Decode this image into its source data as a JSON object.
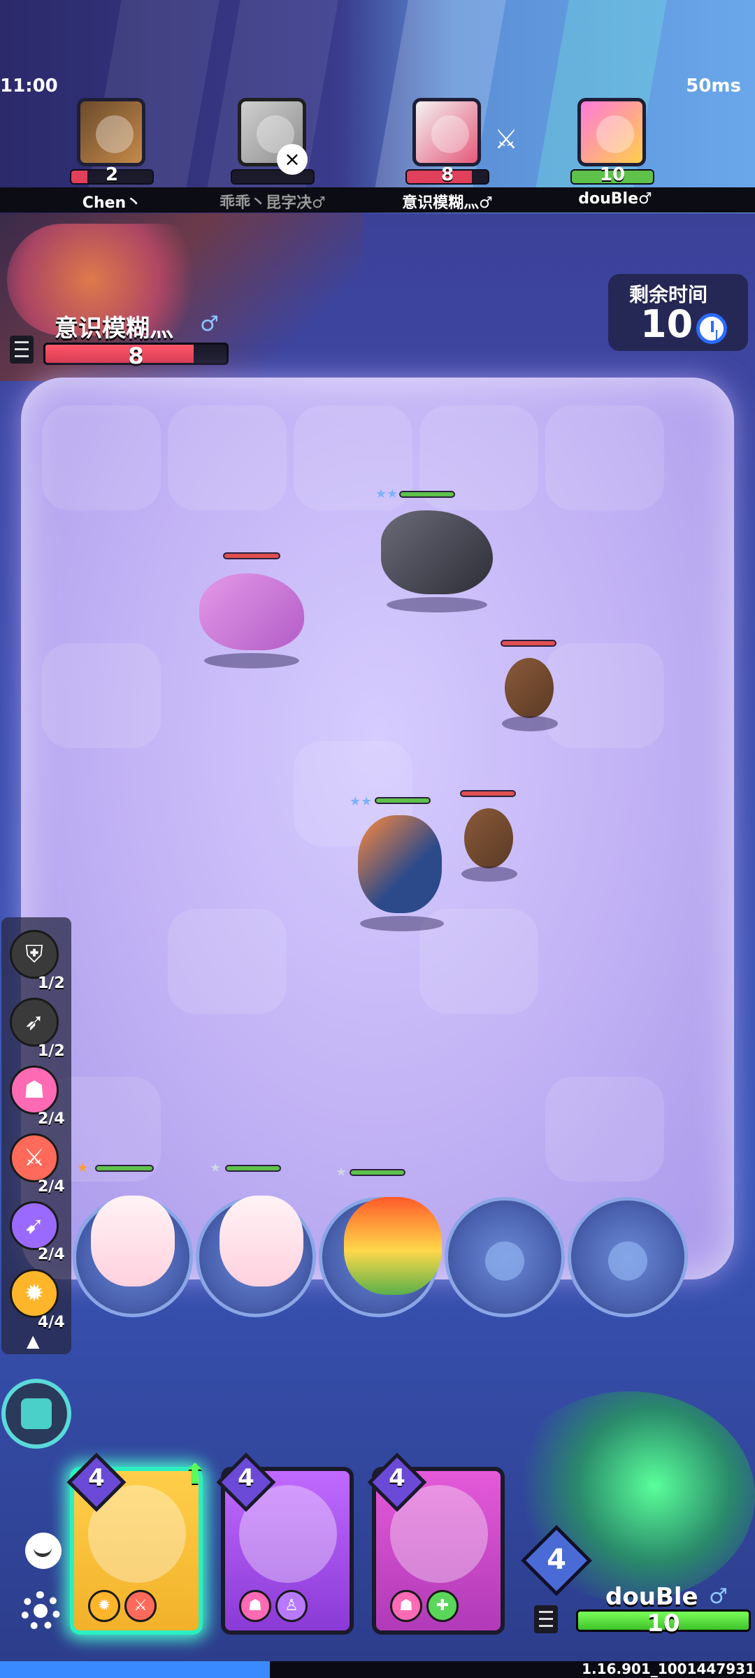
{
  "status": {
    "time": "11:00",
    "ping": "50ms"
  },
  "players": [
    {
      "name": "Chen丶",
      "hp": "2",
      "hp_color": "#e0405a"
    },
    {
      "name": "乖乖丶昆字决♂",
      "hp": "",
      "hp_color": "#e0405a"
    },
    {
      "name": "意识模糊灬♂",
      "hp": "8",
      "hp_color": "#e0405a"
    },
    {
      "name": "douBle♂",
      "hp": "10",
      "hp_color": "#5ec24a"
    }
  ],
  "opponent": {
    "name": "意识模糊灬",
    "gender": "♂",
    "hp": "8",
    "hp_fraction": 0.8
  },
  "timer": {
    "label": "剩余时间",
    "value": "10"
  },
  "traits": [
    {
      "icon": "shield-icon",
      "count": "1/2"
    },
    {
      "icon": "bow-icon",
      "count": "1/2"
    },
    {
      "icon": "pink-mask-icon",
      "count": "2/4"
    },
    {
      "icon": "sword-icon",
      "count": "2/4"
    },
    {
      "icon": "dagger-icon",
      "count": "2/4"
    },
    {
      "icon": "gold-orb-icon",
      "count": "4/4"
    }
  ],
  "cards": [
    {
      "cost": "4"
    },
    {
      "cost": "4"
    },
    {
      "cost": "4"
    }
  ],
  "me": {
    "level": "4",
    "name": "douBle",
    "gender": "♂",
    "hp": "10"
  },
  "version": "1.16.901_1001447931",
  "colors": {
    "accent": "#4affd0",
    "board": "#c2b3f5",
    "enemy_hp": "#e05050",
    "ally_hp": "#5ec24a"
  }
}
